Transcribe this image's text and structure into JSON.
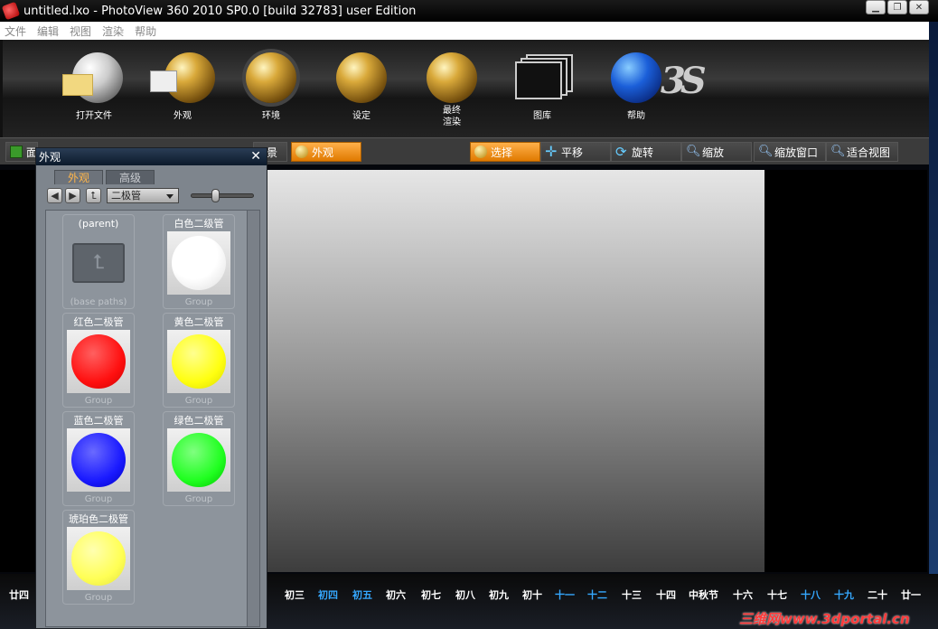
{
  "window": {
    "title": "untitled.lxo - PhotoView 360 2010 SP0.0 [build 32783] user Edition"
  },
  "menu": [
    "文件",
    "编辑",
    "视图",
    "渲染",
    "帮助"
  ],
  "toolbar": {
    "open": "打开文件",
    "appearance": "外观",
    "environment": "环境",
    "settings": "设定",
    "final_render_1": "最终",
    "final_render_2": "渲染",
    "library": "图库",
    "help": "帮助",
    "logo": "3S"
  },
  "tabs": {
    "left_partial": "面",
    "left_partial2": "景",
    "appearance": "外观",
    "select": "选择",
    "pan": "平移",
    "rotate": "旋转",
    "zoom": "缩放",
    "zoom_window": "缩放窗口",
    "fit_view": "适合视图"
  },
  "panel": {
    "title": "外观",
    "tab_appearance": "外观",
    "tab_advanced": "高级",
    "folder": "二极管",
    "items": [
      {
        "name": "(parent)",
        "sub": "(base paths)"
      },
      {
        "name": "白色二级管",
        "sub": "Group",
        "color": "#ffffff"
      },
      {
        "name": "红色二极管",
        "sub": "Group",
        "color": "#ff2020"
      },
      {
        "name": "黄色二极管",
        "sub": "Group",
        "color": "#ffff10"
      },
      {
        "name": "蓝色二极管",
        "sub": "Group",
        "color": "#1a1aff"
      },
      {
        "name": "绿色二极管",
        "sub": "Group",
        "color": "#20ff20"
      },
      {
        "name": "琥珀色二极管",
        "sub": "Group",
        "color": "#ffff55"
      }
    ]
  },
  "calendar": [
    "廿四",
    "初三",
    "初四",
    "初五",
    "初六",
    "初七",
    "初八",
    "初九",
    "初十",
    "十一",
    "十二",
    "十三",
    "十四",
    "中秋节",
    "十六",
    "十七",
    "十八",
    "十九",
    "二十",
    "廿一"
  ],
  "watermark": "三维网www.3dportal.cn",
  "colors": {
    "accent": "#e07a00",
    "panel": "#7e858d"
  }
}
